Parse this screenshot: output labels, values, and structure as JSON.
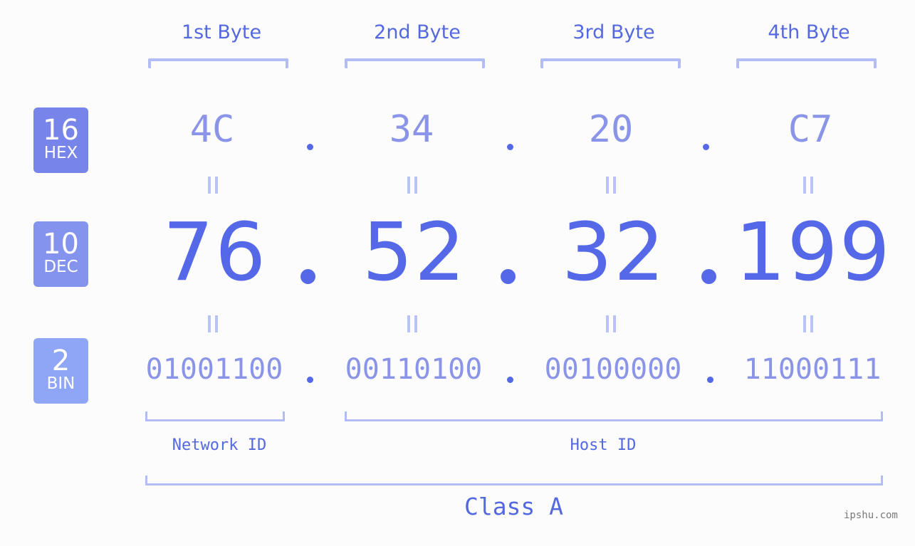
{
  "bytes": {
    "labels": [
      "1st Byte",
      "2nd Byte",
      "3rd Byte",
      "4th Byte"
    ]
  },
  "badges": {
    "hex": {
      "num": "16",
      "abbr": "HEX",
      "color": "#7784ea"
    },
    "dec": {
      "num": "10",
      "abbr": "DEC",
      "color": "#8493ee"
    },
    "bin": {
      "num": "2",
      "abbr": "BIN",
      "color": "#8fa6f6"
    }
  },
  "address": {
    "hex": [
      "4C",
      "34",
      "20",
      "C7"
    ],
    "dec": [
      "76",
      "52",
      "32",
      "199"
    ],
    "bin": [
      "01001100",
      "00110100",
      "00100000",
      "11000111"
    ]
  },
  "segments": {
    "network_id": "Network ID",
    "host_id": "Host ID",
    "ip_class": "Class A"
  },
  "colors": {
    "primary": "#5468e8",
    "secondary": "#8a94e8",
    "bracket": "#b2bdf5"
  },
  "watermark": "ipshu.com"
}
